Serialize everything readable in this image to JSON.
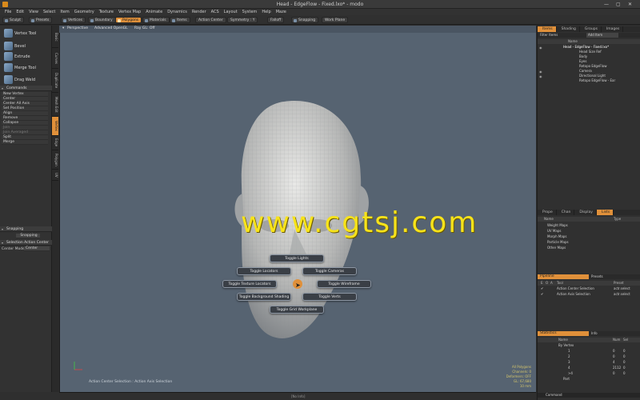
{
  "window": {
    "title": "Head - EdgeFlow - Fixed.lxo* - modo",
    "controls": [
      "—",
      "▢",
      "✕"
    ]
  },
  "menu": [
    "File",
    "Edit",
    "View",
    "Select",
    "Item",
    "Geometry",
    "Texture",
    "Vertex Map",
    "Animate",
    "Dynamics",
    "Render",
    "ACS",
    "Layout",
    "System",
    "Help",
    "Maze"
  ],
  "toolbar": {
    "sculpt": "Sculpt",
    "presets": "Presets",
    "vertices": "Vertices",
    "boundary": "Boundary",
    "polygons": "Polygons",
    "materials": "Materials",
    "items": "Items",
    "action_center": "Action Center",
    "symmetry": "Symmetry : Y",
    "falloff": "Falloff",
    "snapping": "Snapping",
    "work_plane": "Work Plane"
  },
  "tools": [
    "Vertex Tool",
    "Bevel",
    "Extrude",
    "Merge Tool",
    "Drag Weld"
  ],
  "commands": {
    "header": "Commands",
    "items": [
      "New Vertex",
      "Center",
      "Center All Axis",
      "Set Position",
      "Align",
      "Remove",
      "Collapse",
      "Join",
      "Join Averaged",
      "Split",
      "Merge"
    ]
  },
  "left_tabs": [
    "Basic",
    "Curves",
    "Duplicate",
    "Mesh Edit",
    "Vertex",
    "Edge",
    "Polygon",
    "UV"
  ],
  "snapping": {
    "header": "Snapping",
    "button": "Snapping",
    "sel_header": "Selection Action Center",
    "center_mode_label": "Center Mode",
    "center_mode_value": "Center"
  },
  "viewport": {
    "view": "Perspective",
    "shading": "Advanced OpenGL",
    "ray": "Ray GL: Off",
    "watermark": "www.cgtsj.com",
    "pie_menu": [
      "Toggle Lights",
      "Toggle Locators",
      "Toggle Cameras",
      "Toggle Texture Locators",
      "Toggle Wireframe",
      "Toggle Background Shading",
      "Toggle Verts",
      "Toggle Grid Workplane"
    ],
    "status": "Action Center Selection : Action Axis Selection",
    "stats": [
      "All Polygons",
      "Channels: 0",
      "Deformers: OFF",
      "GL: 67,680",
      "10 mm"
    ]
  },
  "bottom": {
    "center": "[No Info]",
    "command": "Command"
  },
  "right": {
    "top_tabs": [
      "Items",
      "Shading",
      "Groups",
      "Images"
    ],
    "filter": "Filter Items",
    "add_item": "Add Item",
    "name_col": "Name",
    "items": [
      "Head - EdgeFlow - Fixed.lxo*",
      "Head Size Ref",
      "Body",
      "Eyes",
      "Retopo EdgeFlow",
      "Camera",
      "Directional Light",
      "Retopo EdgeFlow - Ear"
    ],
    "mid_tabs": [
      "Prope",
      "Chan",
      "Display",
      "Lists"
    ],
    "map_cols": [
      "Name",
      "Type"
    ],
    "maps": [
      "Weight Maps",
      "UV Maps",
      "Morph Maps",
      "Particle Maps",
      "Other Maps"
    ],
    "pipeline_tabs": [
      "Pipeline",
      "Presets"
    ],
    "pipeline_cols": [
      "E",
      "O",
      "A",
      "Tool",
      "Preset"
    ],
    "pipeline": [
      {
        "tool": "Action Center Selection",
        "preset": "actr.select"
      },
      {
        "tool": "Action Axis Selection",
        "preset": "actr.select"
      }
    ],
    "stats_tabs": [
      "Statistics",
      "Info"
    ],
    "stat_cols": [
      "Name",
      "Num",
      "Sel"
    ],
    "stat_group": "By Vertex",
    "stat_rows": [
      {
        "name": "1",
        "num": "0",
        "sel": "0"
      },
      {
        "name": "2",
        "num": "0",
        "sel": "0"
      },
      {
        "name": "3",
        "num": "4",
        "sel": "0"
      },
      {
        "name": "4",
        "num": "2112",
        "sel": "0"
      },
      {
        "name": ">4",
        "num": "0",
        "sel": "0"
      }
    ],
    "stat_part": "Part"
  }
}
